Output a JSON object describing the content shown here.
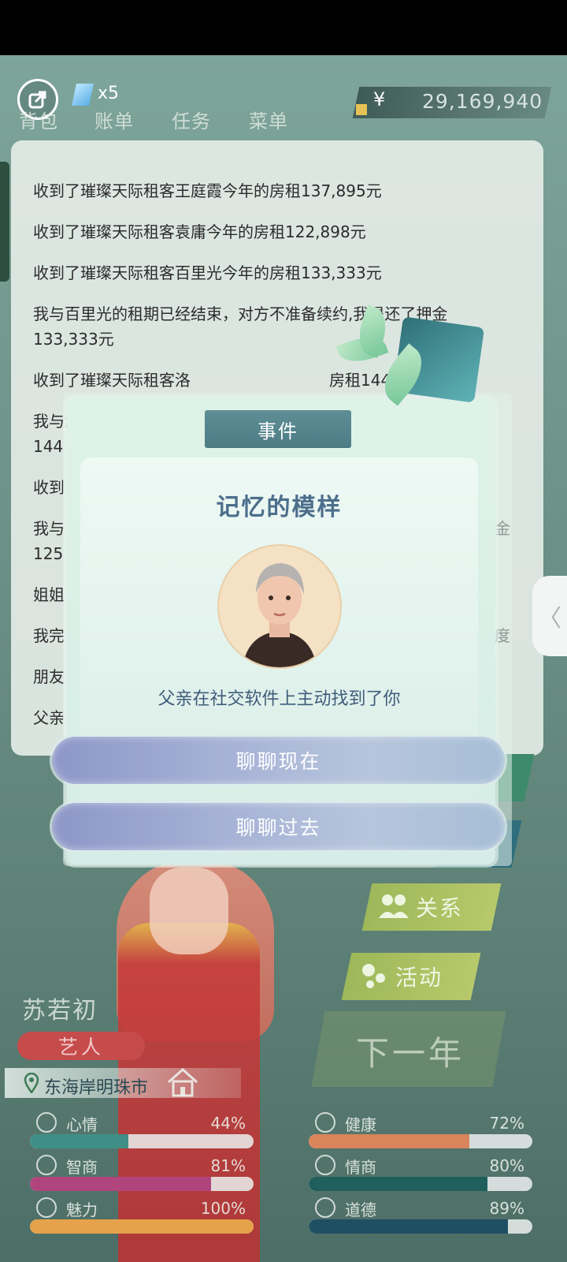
{
  "topbar": {
    "diamond_count": "x5",
    "nav": [
      "背包",
      "账单",
      "任务",
      "菜单"
    ],
    "money_symbol": "¥",
    "money": "29,169,940"
  },
  "log": {
    "lines": [
      "收到了璀璨天际租客王庭霞今年的房租137,895元",
      "收到了璀璨天际租客袁庸今年的房租122,898元",
      "收到了璀璨天际租客百里光今年的房租133,333元",
      "我与百里光的租期已经结束，对方不准备续约,我退还了押金",
      "133,333元",
      "收到了璀璨天际租客洛",
      "房租144,9",
      "我与洛",
      "144",
      "收到",
      "我与",
      "金",
      "125",
      "姐姐",
      "我完",
      "度",
      "朋友",
      "父亲"
    ]
  },
  "dialog": {
    "tag": "事件",
    "title": "记忆的模样",
    "description": "父亲在社交软件上主动找到了你",
    "choices": [
      "聊聊现在",
      "聊聊过去"
    ]
  },
  "game_buttons": {
    "relations": "关系",
    "activity": "活动",
    "next_year": "下一年"
  },
  "character": {
    "name": "苏若初",
    "job": "艺人",
    "location": "东海岸明珠市"
  },
  "stats": [
    {
      "label": "心情",
      "pct_text": "44%",
      "value": 0.44,
      "color": "#3f8f86",
      "icon": "smile-icon"
    },
    {
      "label": "健康",
      "pct_text": "72%",
      "value": 0.72,
      "color": "#d9845a",
      "icon": "heart-icon"
    },
    {
      "label": "智商",
      "pct_text": "81%",
      "value": 0.81,
      "color": "#b0457e",
      "icon": "bulb-icon"
    },
    {
      "label": "情商",
      "pct_text": "80%",
      "value": 0.8,
      "color": "#1f5f5c",
      "icon": "apple-icon"
    },
    {
      "label": "魅力",
      "pct_text": "100%",
      "value": 1.0,
      "color": "#e6a24a",
      "icon": "sparkle-icon"
    },
    {
      "label": "道德",
      "pct_text": "89%",
      "value": 0.89,
      "color": "#1f4f63",
      "icon": "scale-icon"
    }
  ],
  "colors": {
    "accent": "#4c6e8c",
    "choice_button": "#a7b3d6",
    "event_tag": "#5f8e97",
    "job_badge": "#c64b4b"
  }
}
